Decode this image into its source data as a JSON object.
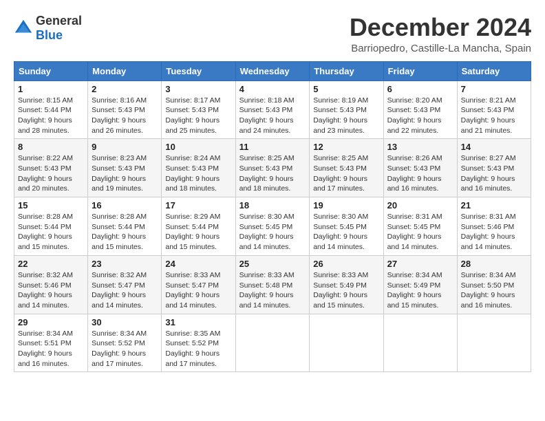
{
  "logo": {
    "text_general": "General",
    "text_blue": "Blue"
  },
  "header": {
    "title": "December 2024",
    "subtitle": "Barriopedro, Castille-La Mancha, Spain"
  },
  "weekdays": [
    "Sunday",
    "Monday",
    "Tuesday",
    "Wednesday",
    "Thursday",
    "Friday",
    "Saturday"
  ],
  "weeks": [
    [
      {
        "day": "1",
        "sunrise": "8:15 AM",
        "sunset": "5:44 PM",
        "daylight": "9 hours and 28 minutes."
      },
      {
        "day": "2",
        "sunrise": "8:16 AM",
        "sunset": "5:43 PM",
        "daylight": "9 hours and 26 minutes."
      },
      {
        "day": "3",
        "sunrise": "8:17 AM",
        "sunset": "5:43 PM",
        "daylight": "9 hours and 25 minutes."
      },
      {
        "day": "4",
        "sunrise": "8:18 AM",
        "sunset": "5:43 PM",
        "daylight": "9 hours and 24 minutes."
      },
      {
        "day": "5",
        "sunrise": "8:19 AM",
        "sunset": "5:43 PM",
        "daylight": "9 hours and 23 minutes."
      },
      {
        "day": "6",
        "sunrise": "8:20 AM",
        "sunset": "5:43 PM",
        "daylight": "9 hours and 22 minutes."
      },
      {
        "day": "7",
        "sunrise": "8:21 AM",
        "sunset": "5:43 PM",
        "daylight": "9 hours and 21 minutes."
      }
    ],
    [
      {
        "day": "8",
        "sunrise": "8:22 AM",
        "sunset": "5:43 PM",
        "daylight": "9 hours and 20 minutes."
      },
      {
        "day": "9",
        "sunrise": "8:23 AM",
        "sunset": "5:43 PM",
        "daylight": "9 hours and 19 minutes."
      },
      {
        "day": "10",
        "sunrise": "8:24 AM",
        "sunset": "5:43 PM",
        "daylight": "9 hours and 18 minutes."
      },
      {
        "day": "11",
        "sunrise": "8:25 AM",
        "sunset": "5:43 PM",
        "daylight": "9 hours and 18 minutes."
      },
      {
        "day": "12",
        "sunrise": "8:25 AM",
        "sunset": "5:43 PM",
        "daylight": "9 hours and 17 minutes."
      },
      {
        "day": "13",
        "sunrise": "8:26 AM",
        "sunset": "5:43 PM",
        "daylight": "9 hours and 16 minutes."
      },
      {
        "day": "14",
        "sunrise": "8:27 AM",
        "sunset": "5:43 PM",
        "daylight": "9 hours and 16 minutes."
      }
    ],
    [
      {
        "day": "15",
        "sunrise": "8:28 AM",
        "sunset": "5:44 PM",
        "daylight": "9 hours and 15 minutes."
      },
      {
        "day": "16",
        "sunrise": "8:28 AM",
        "sunset": "5:44 PM",
        "daylight": "9 hours and 15 minutes."
      },
      {
        "day": "17",
        "sunrise": "8:29 AM",
        "sunset": "5:44 PM",
        "daylight": "9 hours and 15 minutes."
      },
      {
        "day": "18",
        "sunrise": "8:30 AM",
        "sunset": "5:45 PM",
        "daylight": "9 hours and 14 minutes."
      },
      {
        "day": "19",
        "sunrise": "8:30 AM",
        "sunset": "5:45 PM",
        "daylight": "9 hours and 14 minutes."
      },
      {
        "day": "20",
        "sunrise": "8:31 AM",
        "sunset": "5:45 PM",
        "daylight": "9 hours and 14 minutes."
      },
      {
        "day": "21",
        "sunrise": "8:31 AM",
        "sunset": "5:46 PM",
        "daylight": "9 hours and 14 minutes."
      }
    ],
    [
      {
        "day": "22",
        "sunrise": "8:32 AM",
        "sunset": "5:46 PM",
        "daylight": "9 hours and 14 minutes."
      },
      {
        "day": "23",
        "sunrise": "8:32 AM",
        "sunset": "5:47 PM",
        "daylight": "9 hours and 14 minutes."
      },
      {
        "day": "24",
        "sunrise": "8:33 AM",
        "sunset": "5:47 PM",
        "daylight": "9 hours and 14 minutes."
      },
      {
        "day": "25",
        "sunrise": "8:33 AM",
        "sunset": "5:48 PM",
        "daylight": "9 hours and 14 minutes."
      },
      {
        "day": "26",
        "sunrise": "8:33 AM",
        "sunset": "5:49 PM",
        "daylight": "9 hours and 15 minutes."
      },
      {
        "day": "27",
        "sunrise": "8:34 AM",
        "sunset": "5:49 PM",
        "daylight": "9 hours and 15 minutes."
      },
      {
        "day": "28",
        "sunrise": "8:34 AM",
        "sunset": "5:50 PM",
        "daylight": "9 hours and 16 minutes."
      }
    ],
    [
      {
        "day": "29",
        "sunrise": "8:34 AM",
        "sunset": "5:51 PM",
        "daylight": "9 hours and 16 minutes."
      },
      {
        "day": "30",
        "sunrise": "8:34 AM",
        "sunset": "5:52 PM",
        "daylight": "9 hours and 17 minutes."
      },
      {
        "day": "31",
        "sunrise": "8:35 AM",
        "sunset": "5:52 PM",
        "daylight": "9 hours and 17 minutes."
      },
      null,
      null,
      null,
      null
    ]
  ],
  "labels": {
    "sunrise": "Sunrise:",
    "sunset": "Sunset:",
    "daylight": "Daylight: "
  }
}
